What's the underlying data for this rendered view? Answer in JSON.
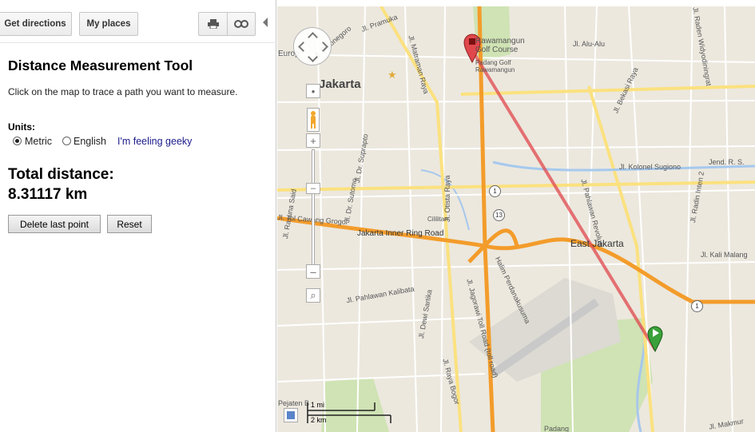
{
  "toolbar": {
    "directions_label": "Get directions",
    "places_label": "My places",
    "print_icon": "print-icon",
    "link_icon": "link-icon"
  },
  "tool": {
    "title": "Distance Measurement Tool",
    "description": "Click on the map to trace a path you want to measure.",
    "units_label": "Units:",
    "units": [
      {
        "label": "Metric",
        "selected": true
      },
      {
        "label": "English",
        "selected": false
      }
    ],
    "geeky_link": "I'm feeling geeky",
    "total_label": "Total distance:",
    "total_value": "8.31117 km",
    "delete_label": "Delete last point",
    "reset_label": "Reset"
  },
  "map": {
    "labels": {
      "jakarta": "Jakarta",
      "east_jakarta": "East Jakarta",
      "golf": "Rawamangun Golf Course",
      "golf_sub": "Padang Golf Rawamangun",
      "pramuka": "Jl. Pramuka",
      "diponegoro": "Jl. Diponegoro",
      "matraman": "Jl. Matraman Raya",
      "alu_alu": "Jl. Alu-Alu",
      "bekasi_raya": "Jl. Bekasi Raya",
      "kolonel": "Jl. Kolonel Sugiono",
      "jend_r": "Jend. R. S.",
      "inner_ring": "Jakarta Inner Ring Road",
      "tol_cawang": "Jl. Tol Cawang Grogol",
      "jagorawi": "Jl. Jagorawi Toll Road (toll road)",
      "pahlawan_kalibata": "Jl. Pahlawan Kalibata",
      "dewi_sartika": "Jl. Dewi Sartika",
      "raya_bogor": "Jl. Raya Bogor",
      "otista": "Jl. Otista Raya",
      "halim": "Halim Perdanakusuma",
      "cililitan": "Cililitan",
      "kali_malang": "Jl. Kali Malang",
      "pahlawan_revolusi": "Jl. Pahlawan Revolusi",
      "radin_inten": "Jl. Radin Inten 2",
      "sutomo": "Jl. Dr. Sutomo",
      "suprapto": "Jl. Dr. Suprapto",
      "rasuna": "Jl. Rasuna Said",
      "pejaten": "Pejaten B",
      "padang": "Padang",
      "makmur": "Jl. Makmur",
      "widyodiningrat": "Jl. Raden Widyodiningrat",
      "cop": "Europ"
    },
    "shields": [
      "1",
      "13",
      "1"
    ],
    "scale": {
      "top": "1 mi",
      "bottom": "2 km"
    },
    "measure_line_color": "#e0474c",
    "toll_road_color": "#f39c2b"
  }
}
